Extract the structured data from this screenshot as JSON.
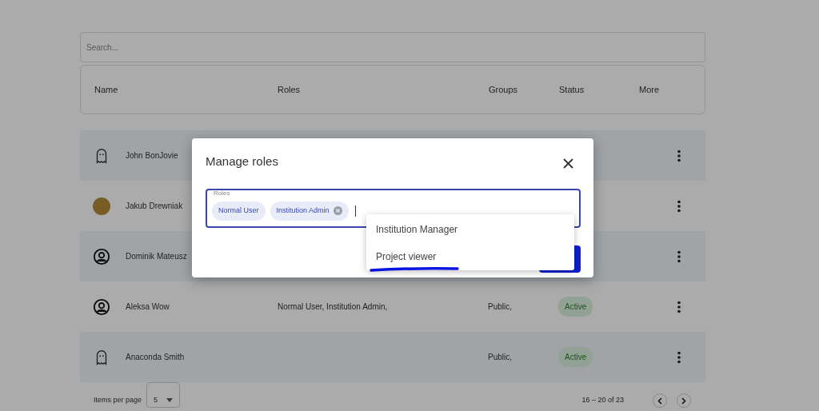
{
  "search": {
    "placeholder": "Search..."
  },
  "columns": [
    "Name",
    "Roles",
    "Groups",
    "Status",
    "More"
  ],
  "rows": [
    {
      "kind": "ghost",
      "name": "John BonJovie"
    },
    {
      "kind": "photo",
      "name": "Jakub Drewniak"
    },
    {
      "kind": "person",
      "name": "Dominik Mateusz"
    },
    {
      "kind": "person",
      "name": "Aleksa Wow",
      "roles": "Normal User, Institution Admin,",
      "groups": "Public,",
      "status": "Active"
    },
    {
      "kind": "ghost",
      "name": "Anaconda Smith",
      "groups": "Public,",
      "status": "Active"
    }
  ],
  "pagination": {
    "items_per_page_label": "Items per page",
    "page_size": "5",
    "range": "16 – 20 of 23"
  },
  "dialog": {
    "title": "Manage roles",
    "field_label": "Roles",
    "chips": [
      {
        "label": "Normal User",
        "removable": false
      },
      {
        "label": "Institution Admin",
        "removable": true
      }
    ],
    "options": [
      {
        "label": "Institution Manager",
        "underlined": false
      },
      {
        "label": "Project viewer",
        "underlined": true
      }
    ]
  }
}
